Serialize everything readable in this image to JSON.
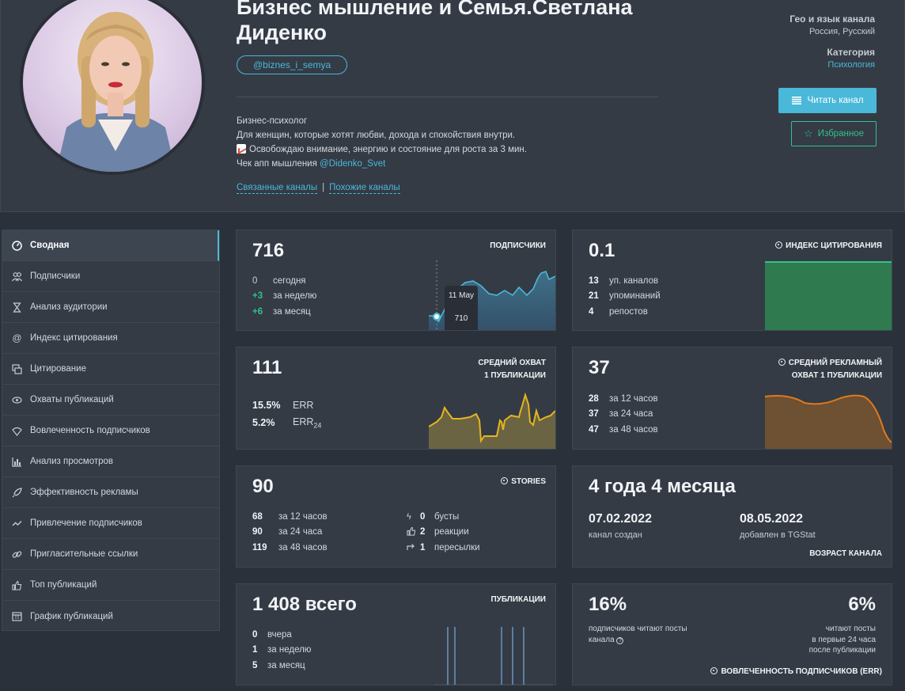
{
  "channel": {
    "title": "Бизнес мышление и Семья.Светлана Диденко",
    "handle": "@biznes_i_semya",
    "description": {
      "line1": "Бизнес-психолог",
      "line2": "Для женщин, которые хотят любви, дохода и спокойствия внутри.",
      "line3": "Освобождаю внимание, энергию и состояние для роста за 3 мин.",
      "line4_prefix": "Чек апп мышления ",
      "line4_link": "@Didenko_Svet"
    },
    "related_link": "Связанные каналы",
    "similar_link": "Похожие каналы",
    "link_separator": "|",
    "geo_label": "Гео и язык канала",
    "geo_value": "Россия, Русский",
    "category_label": "Категория",
    "category_value": "Психология",
    "read_button": "Читать канал",
    "favorite_button": "Избранное"
  },
  "sidebar": {
    "items": [
      {
        "label": "Сводная",
        "icon": "dashboard-icon"
      },
      {
        "label": "Подписчики",
        "icon": "users-icon"
      },
      {
        "label": "Анализ аудитории",
        "icon": "hourglass-icon"
      },
      {
        "label": "Индекс цитирования",
        "icon": "at-icon"
      },
      {
        "label": "Цитирование",
        "icon": "quote-icon"
      },
      {
        "label": "Охваты публикаций",
        "icon": "eye-icon"
      },
      {
        "label": "Вовлеченность подписчиков",
        "icon": "engagement-icon"
      },
      {
        "label": "Анализ просмотров",
        "icon": "bar-chart-icon"
      },
      {
        "label": "Эффективность рекламы",
        "icon": "rocket-icon"
      },
      {
        "label": "Привлечение подписчиков",
        "icon": "trend-icon"
      },
      {
        "label": "Пригласительные ссылки",
        "icon": "link-icon"
      },
      {
        "label": "Топ публикаций",
        "icon": "thumbs-up-icon"
      },
      {
        "label": "График публикаций",
        "icon": "calendar-icon"
      }
    ]
  },
  "subscribers": {
    "total": "716",
    "title": "ПОДПИСЧИКИ",
    "rows": [
      {
        "n": "0",
        "label": "сегодня"
      },
      {
        "n": "+3",
        "label": "за неделю"
      },
      {
        "n": "+6",
        "label": "за месяц"
      }
    ],
    "tooltip_date": "11 May",
    "tooltip_value": "710"
  },
  "citation": {
    "value": "0.1",
    "title": "ИНДЕКС ЦИТИРОВАНИЯ",
    "rows": [
      {
        "n": "13",
        "label": "уп. каналов"
      },
      {
        "n": "21",
        "label": "упоминаний"
      },
      {
        "n": "4",
        "label": "репостов"
      }
    ]
  },
  "reach": {
    "value": "111",
    "title1": "СРЕДНИЙ ОХВАТ",
    "title2": "1 ПУБЛИКАЦИИ",
    "err": "15.5%",
    "err_label": "ERR",
    "err24": "5.2%",
    "err24_label": "ERR",
    "err24_sub": "24"
  },
  "ad_reach": {
    "value": "37",
    "title1": "СРЕДНИЙ РЕКЛАМНЫЙ",
    "title2": "ОХВАТ 1 ПУБЛИКАЦИИ",
    "rows": [
      {
        "n": "28",
        "label": "за 12 часов"
      },
      {
        "n": "37",
        "label": "за 24 часа"
      },
      {
        "n": "47",
        "label": "за 48 часов"
      }
    ]
  },
  "stories": {
    "value": "90",
    "title": "STORIES",
    "rows": [
      {
        "n": "68",
        "label": "за 12 часов"
      },
      {
        "n": "90",
        "label": "за 24 часа"
      },
      {
        "n": "119",
        "label": "за 48 часов"
      }
    ],
    "right_rows": [
      {
        "n": "0",
        "label": "бусты",
        "icon": "bolt-icon"
      },
      {
        "n": "2",
        "label": "реакции",
        "icon": "thumbs-up-icon"
      },
      {
        "n": "1",
        "label": "пересылки",
        "icon": "forward-icon"
      }
    ]
  },
  "age": {
    "value": "4 года 4 месяца",
    "created_date": "07.02.2022",
    "created_label": "канал создан",
    "added_date": "08.05.2022",
    "added_label": "добавлен в TGStat",
    "title": "ВОЗРАСТ КАНАЛА"
  },
  "posts": {
    "value": "1 408 всего",
    "title": "ПУБЛИКАЦИИ",
    "rows": [
      {
        "n": "0",
        "label": "вчера"
      },
      {
        "n": "1",
        "label": "за неделю"
      },
      {
        "n": "5",
        "label": "за месяц"
      }
    ]
  },
  "engagement": {
    "left_value": "16%",
    "left_text1": "подписчиков читают посты",
    "left_text2": "канала",
    "right_value": "6%",
    "right_text1": "читают посты",
    "right_text2": "в первые 24 часа",
    "right_text3": "после публикации",
    "title": "ВОВЛЕЧЕННОСТЬ ПОДПИСЧИКОВ (ERR)"
  },
  "colors": {
    "accent": "#4ab8d8",
    "green": "#33c08a",
    "subs_line": "#4ab8d8",
    "citation_fill": "#2f7a4e",
    "reach_line": "#e5b51e",
    "ad_line": "#e07a1a"
  }
}
